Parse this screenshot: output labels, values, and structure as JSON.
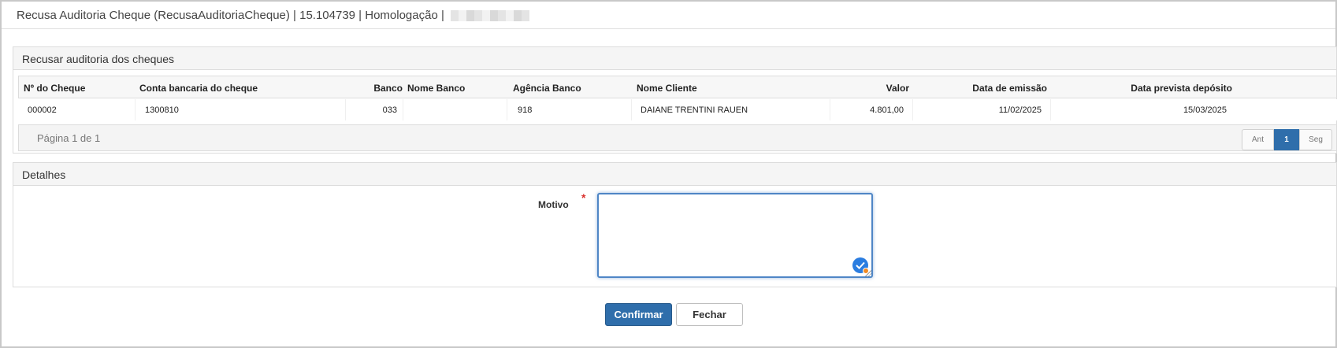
{
  "window": {
    "title": "Recusa Auditoria Cheque (RecusaAuditoriaCheque) | 15.104739 | Homologação |"
  },
  "cheques_panel": {
    "title": "Recusar auditoria dos cheques",
    "columns": [
      "Nº do Cheque",
      "Conta bancaria do cheque",
      "Banco",
      "Nome Banco",
      "Agência Banco",
      "Nome Cliente",
      "Valor",
      "Data de emissão",
      "Data prevista depósito"
    ],
    "rows": [
      [
        "000002",
        "1300810",
        "033",
        "",
        "918",
        "DAIANE TRENTINI RAUEN",
        "4.801,00",
        "11/02/2025",
        "15/03/2025"
      ]
    ],
    "pagination": {
      "info": "Página 1 de 1",
      "prev_label": "Ant",
      "current_page": "1",
      "next_label": "Seg"
    }
  },
  "details_panel": {
    "title": "Detalhes",
    "motivo_label": "Motivo",
    "required_mark": "*",
    "motivo_value": ""
  },
  "actions": {
    "confirm_label": "Confirmar",
    "close_label": "Fechar"
  },
  "colors": {
    "primary": "#2f6eab",
    "required": "#d9302c",
    "focus_border": "#4f86c6",
    "header_bg": "#f5f5f5"
  }
}
